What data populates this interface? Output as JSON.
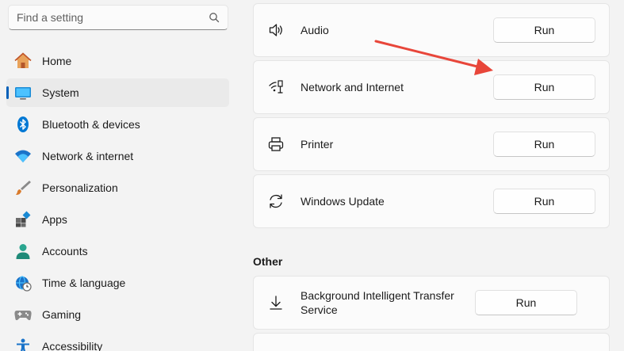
{
  "search": {
    "placeholder": "Find a setting",
    "icon": "search-icon"
  },
  "sidebar": {
    "items": [
      {
        "label": "Home",
        "icon": "home-icon",
        "selected": false
      },
      {
        "label": "System",
        "icon": "monitor-icon",
        "selected": true
      },
      {
        "label": "Bluetooth & devices",
        "icon": "bluetooth-icon",
        "selected": false
      },
      {
        "label": "Network & internet",
        "icon": "wifi-icon",
        "selected": false
      },
      {
        "label": "Personalization",
        "icon": "brush-icon",
        "selected": false
      },
      {
        "label": "Apps",
        "icon": "apps-icon",
        "selected": false
      },
      {
        "label": "Accounts",
        "icon": "person-icon",
        "selected": false
      },
      {
        "label": "Time & language",
        "icon": "globe-clock-icon",
        "selected": false
      },
      {
        "label": "Gaming",
        "icon": "gamepad-icon",
        "selected": false
      },
      {
        "label": "Accessibility",
        "icon": "accessibility-icon",
        "selected": false
      }
    ]
  },
  "troubleshooters": [
    {
      "label": "Audio",
      "icon": "speaker-icon",
      "button": "Run"
    },
    {
      "label": "Network and Internet",
      "icon": "network-icon",
      "button": "Run"
    },
    {
      "label": "Printer",
      "icon": "printer-icon",
      "button": "Run"
    },
    {
      "label": "Windows Update",
      "icon": "sync-icon",
      "button": "Run"
    }
  ],
  "other": {
    "title": "Other",
    "items": [
      {
        "label": "Background Intelligent Transfer Service",
        "icon": "download-icon",
        "button": "Run"
      }
    ]
  },
  "colors": {
    "accent": "#005fb8",
    "annotation_arrow": "#e8463a"
  }
}
